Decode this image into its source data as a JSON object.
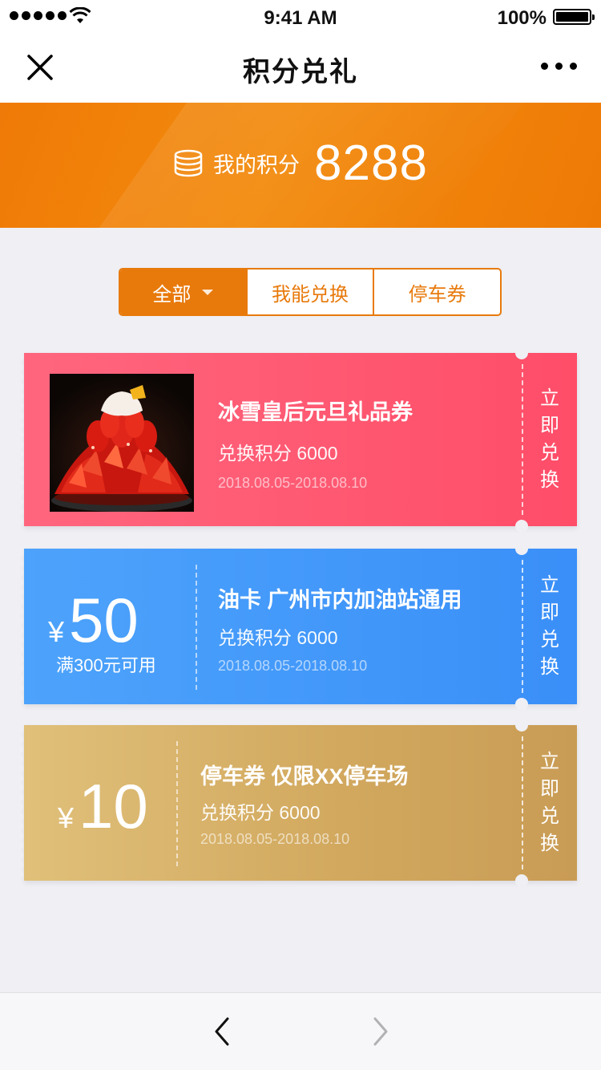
{
  "status": {
    "time": "9:41 AM",
    "battery": "100%"
  },
  "nav": {
    "title": "积分兑礼",
    "close_icon": "close-icon",
    "more_icon": "more-icon"
  },
  "points": {
    "label": "我的积分",
    "value": "8288",
    "icon": "coins-icon"
  },
  "filters": [
    {
      "label": "全部",
      "active": true
    },
    {
      "label": "我能兑换",
      "active": false
    },
    {
      "label": "停车券",
      "active": false
    }
  ],
  "coupons": [
    {
      "title": "冰雪皇后元旦礼品券",
      "points": "兑换积分 6000",
      "date": "2018.08.05-2018.08.10",
      "action": [
        "立",
        "即",
        "兑",
        "换"
      ],
      "color": "#ff5a72"
    },
    {
      "currency": "¥",
      "amount": "50",
      "condition": "满300元可用",
      "title": "油卡 广州市内加油站通用",
      "points": "兑换积分 6000",
      "date": "2018.08.05-2018.08.10",
      "action": [
        "立",
        "即",
        "兑",
        "换"
      ],
      "color": "#3f95f9"
    },
    {
      "currency": "¥",
      "amount": "10",
      "title": "停车券 仅限XX停车场",
      "points": "兑换积分 6000",
      "date": "2018.08.05-2018.08.10",
      "action": [
        "立",
        "即",
        "兑",
        "换"
      ],
      "color": "#d4ab62"
    }
  ],
  "accent_color": "#e87a0c"
}
